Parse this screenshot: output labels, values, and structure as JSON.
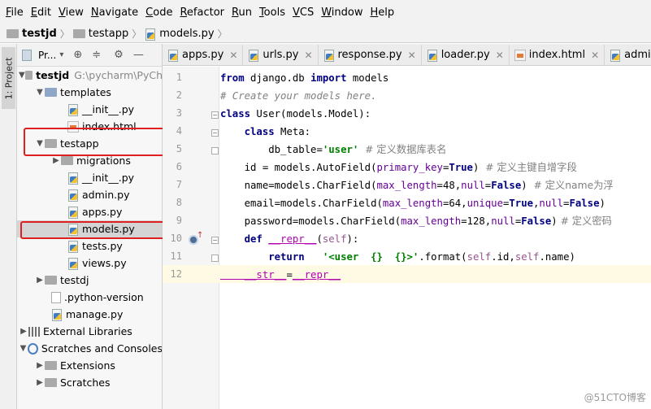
{
  "menubar": [
    {
      "mnemonic": "F",
      "rest": "ile"
    },
    {
      "mnemonic": "E",
      "rest": "dit"
    },
    {
      "mnemonic": "V",
      "rest": "iew"
    },
    {
      "mnemonic": "N",
      "rest": "avigate"
    },
    {
      "mnemonic": "C",
      "rest": "ode"
    },
    {
      "mnemonic": "R",
      "rest": "efactor"
    },
    {
      "mnemonic": "R",
      "rest": "un",
      "pre": ""
    },
    {
      "mnemonic": "T",
      "rest": "ools"
    },
    {
      "mnemonic": "V",
      "rest": "CS"
    },
    {
      "mnemonic": "W",
      "rest": "indow"
    },
    {
      "mnemonic": "H",
      "rest": "elp"
    }
  ],
  "breadcrumb": [
    "testjd",
    "testapp",
    "models.py"
  ],
  "toolstrip": {
    "project_tab": "1: Project"
  },
  "panel": {
    "title": "Pr..."
  },
  "tree": {
    "root": "testjd",
    "root_path": "G:\\pycharm\\PyCh",
    "templates": "templates",
    "init1": "__init__.py",
    "index": "index.html",
    "testapp": "testapp",
    "migrations": "migrations",
    "init2": "__init__.py",
    "admin": "admin.py",
    "apps": "apps.py",
    "models": "models.py",
    "tests": "tests.py",
    "views": "views.py",
    "testdj": "testdj",
    "pyversion": ".python-version",
    "manage": "manage.py",
    "extlibs": "External Libraries",
    "scratches_consoles": "Scratches and Consoles",
    "extensions": "Extensions",
    "scratches": "Scratches"
  },
  "tabs": [
    "apps.py",
    "urls.py",
    "response.py",
    "loader.py",
    "index.html",
    "admin.py"
  ],
  "line_numbers": [
    "1",
    "2",
    "3",
    "4",
    "5",
    "6",
    "7",
    "8",
    "9",
    "10",
    "11",
    "12"
  ],
  "code": {
    "l1_from": "from",
    "l1_mod": " django.db ",
    "l1_import": "import",
    "l1_name": " models",
    "l2": "# Create your models here.",
    "l3_class": "class",
    "l3_rest": " User(models.Model):",
    "l4_class": "    class",
    "l4_rest": " Meta:",
    "l5_a": "        db_table=",
    "l5_str": "'user'",
    "l5_cmt": "  # 定义数据库表名",
    "l6_a": "    id = models.AutoField(",
    "l6_k": "primary_key",
    "l6_b": "=",
    "l6_v": "True",
    "l6_c": ")",
    "l6_cmt": "  # 定义主键自增字段",
    "l7_a": "    name=models.CharField(",
    "l7_k1": "max_length",
    "l7_b": "=48,",
    "l7_k2": "null",
    "l7_c": "=",
    "l7_v": "False",
    "l7_d": ")",
    "l7_cmt": "  # 定义name为浮",
    "l8_a": "    email=models.CharField(",
    "l8_k1": "max_length",
    "l8_b": "=64,",
    "l8_k2": "unique",
    "l8_c": "=",
    "l8_v1": "True",
    "l8_d": ",",
    "l8_k3": "null",
    "l8_e": "=",
    "l8_v2": "False",
    "l8_f": ")",
    "l9_a": "    password=models.CharField(",
    "l9_k1": "max_length",
    "l9_b": "=128,",
    "l9_k2": "null",
    "l9_c": "=",
    "l9_v": "False",
    "l9_d": ")",
    "l9_cmt": " # 定义密码",
    "l10_def": "    def",
    "l10_sp": " ",
    "l10_name": "__repr__",
    "l10_rest": "(",
    "l10_self": "self",
    "l10_end": "):",
    "l11_ret": "        return",
    "l11_sp": "   ",
    "l11_str": "'<user  {}  {}>'",
    "l11_a": ".format(",
    "l11_s1": "self",
    "l11_b": ".id,",
    "l11_s2": "self",
    "l11_c": ".name)",
    "l12_a": "    __str__",
    "l12_b": "=",
    "l12_c": "__repr__"
  },
  "watermark": "@51CTO博客"
}
